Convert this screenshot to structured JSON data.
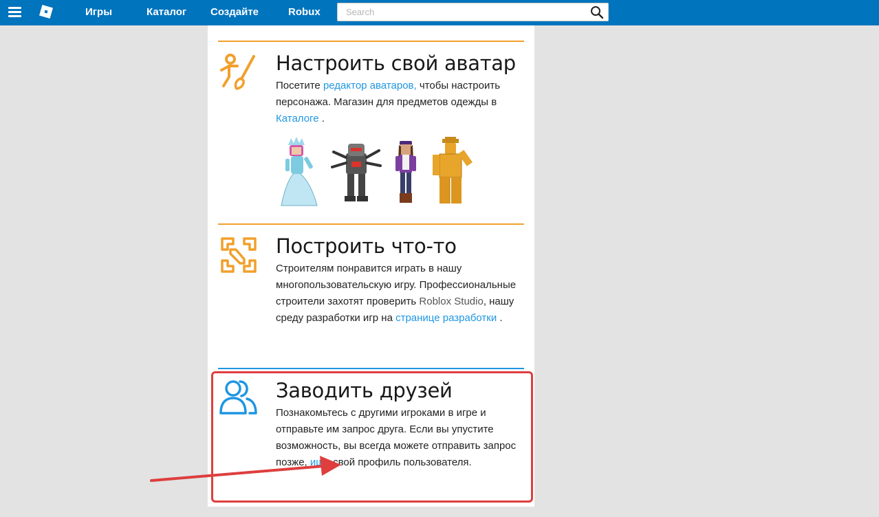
{
  "nav": {
    "games": "Игры",
    "catalog": "Каталог",
    "create": "Создайте",
    "robux": "Robux"
  },
  "search": {
    "placeholder": "Search",
    "value": ""
  },
  "sections": [
    {
      "title": "Настроить свой аватар",
      "icon": "avatar-brush-icon",
      "text_1": "Посетите ",
      "link_1": "редактор аватаров,",
      "text_2": " чтобы настроить персонажа. Магазин для предметов одежды в ",
      "link_2": "Каталоге",
      "text_3": " ."
    },
    {
      "title": "Построить что-то",
      "icon": "build-tools-icon",
      "text_1": "Строителям понравится играть в нашу многопользовательскую игру. Профессиональные строители захотят проверить ",
      "studio": "Roblox Studio",
      "text_2": ", нашу среду разработки игр на ",
      "link_1": "странице разработки",
      "text_3": " ."
    },
    {
      "title": "Заводить друзей",
      "icon": "friends-icon",
      "text_1": "Познакомьтесь с другими игроками в игре и отправьте им запрос друга. Если вы упустите возможность, вы всегда можете отправить запрос позже, ",
      "link_1": "ища",
      "text_2": " свой профиль пользователя."
    }
  ],
  "colors": {
    "topbar": "#0074bd",
    "accent_orange": "#f1a02d",
    "accent_blue": "#1e96e2",
    "highlight_red": "#de3e3e"
  }
}
